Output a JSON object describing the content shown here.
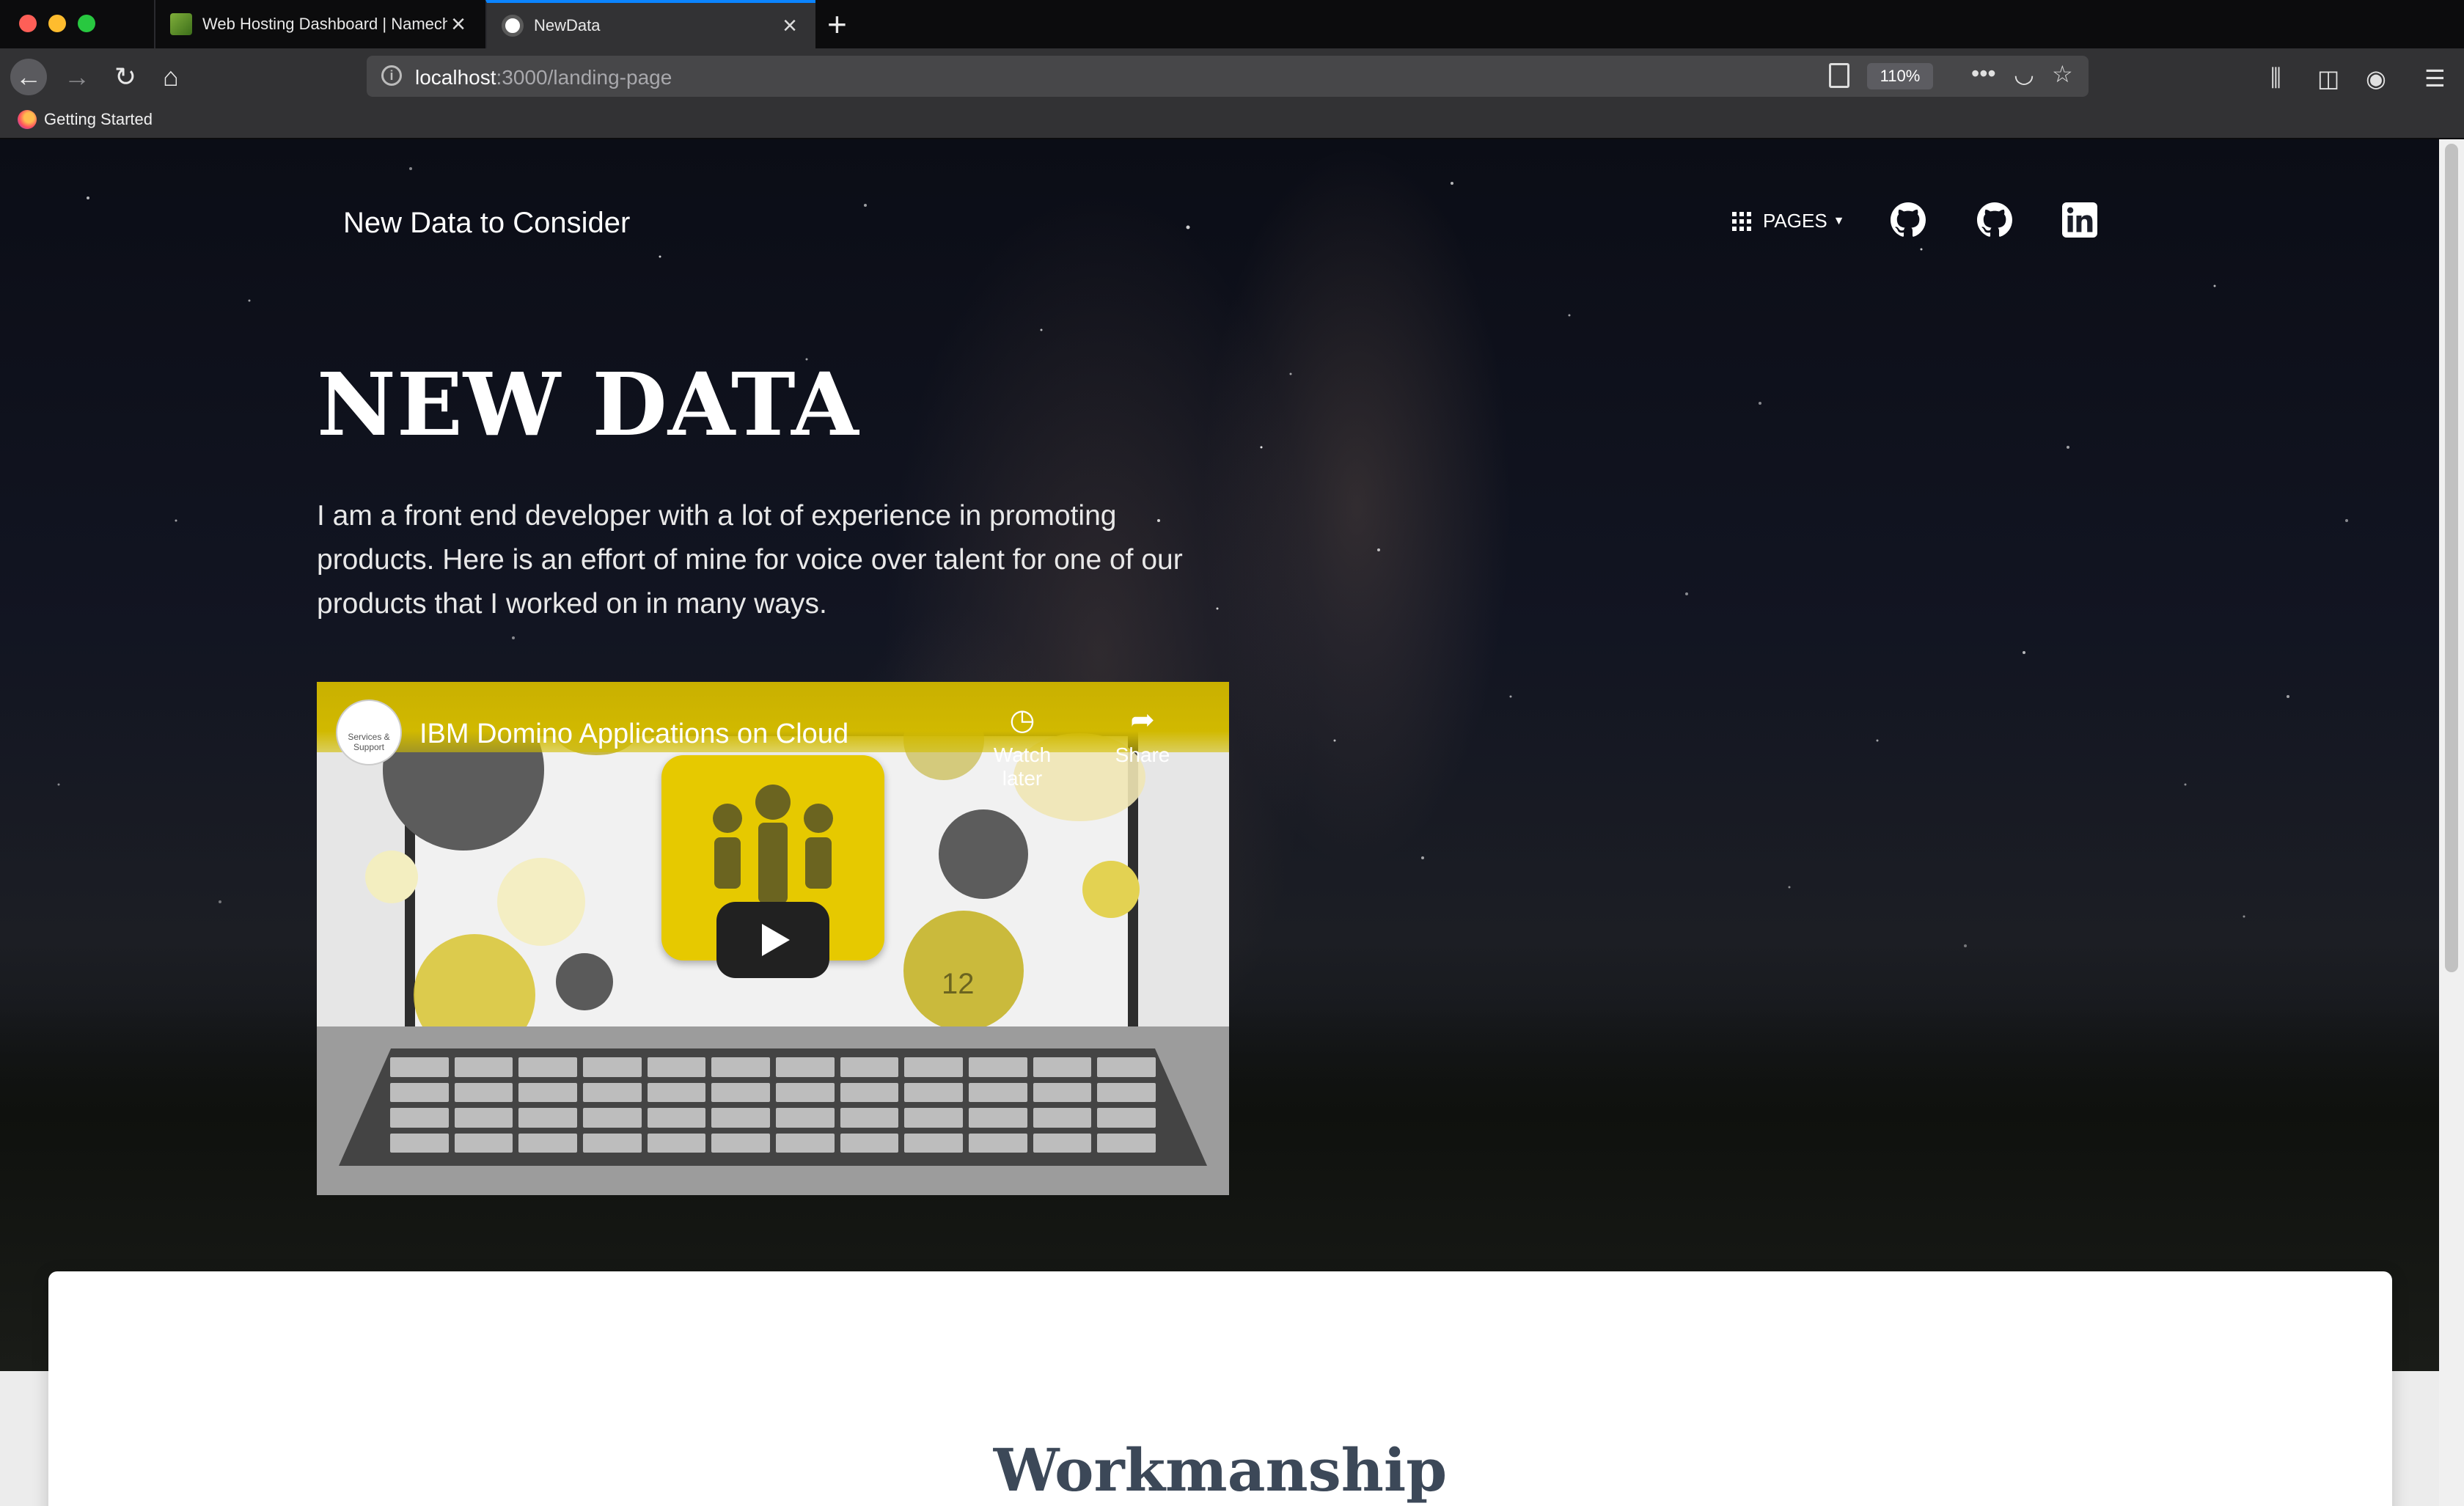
{
  "browser": {
    "tabs": [
      {
        "title": "Web Hosting Dashboard | Namecheap",
        "active": false
      },
      {
        "title": "NewData",
        "active": true
      }
    ],
    "url": {
      "host": "localhost",
      "path": ":3000/landing-page"
    },
    "zoom": "110%",
    "bookmarks": [
      {
        "label": "Getting Started"
      }
    ]
  },
  "site": {
    "brand": "New Data to Consider",
    "pages_label": "PAGES",
    "social": [
      "github-icon",
      "github-icon",
      "linkedin-icon"
    ]
  },
  "hero": {
    "title": "NEW DATA",
    "description": "I am a front end developer with a lot of experience in promoting products. Here is an effort of mine for voice over talent for one of our products that I worked on in many ways."
  },
  "video": {
    "title": "IBM Domino Applications on Cloud",
    "channel": "Services & Support",
    "watch_later": "Watch later",
    "share": "Share",
    "calendar_day": "12",
    "accent_color": "#e6c900"
  },
  "section": {
    "title": "Workmanship"
  }
}
